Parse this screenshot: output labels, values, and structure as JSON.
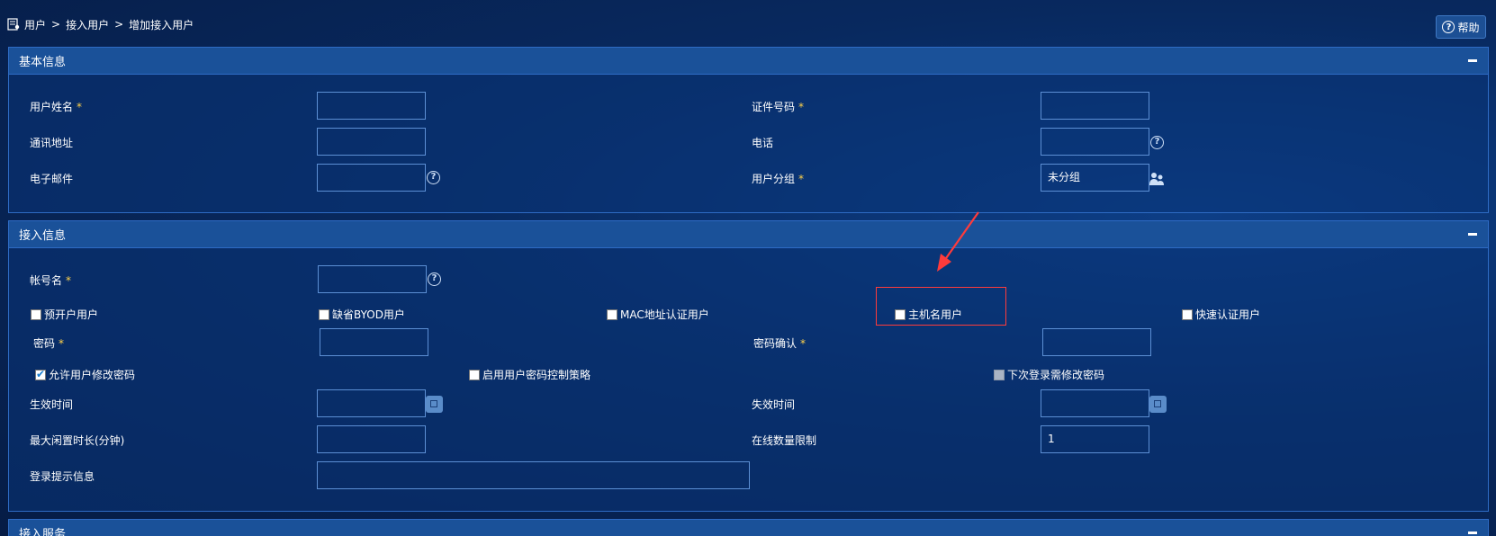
{
  "breadcrumb": {
    "items": [
      "用户",
      "接入用户",
      "增加接入用户"
    ],
    "separator": ">"
  },
  "help": {
    "label": "帮助"
  },
  "basic_panel": {
    "title": "基本信息",
    "fields": {
      "name": {
        "label": "用户姓名",
        "value": ""
      },
      "id_number": {
        "label": "证件号码",
        "value": ""
      },
      "address": {
        "label": "通讯地址",
        "value": ""
      },
      "phone": {
        "label": "电话",
        "value": ""
      },
      "email": {
        "label": "电子邮件",
        "value": ""
      },
      "group": {
        "label": "用户分组",
        "value": "未分组"
      }
    }
  },
  "access_panel": {
    "title": "接入信息",
    "account": {
      "label": "帐号名",
      "value": ""
    },
    "user_types": {
      "preopen": "预开户用户",
      "byod": "缺省BYOD用户",
      "mac": "MAC地址认证用户",
      "hostname": "主机名用户",
      "quick": "快速认证用户"
    },
    "password": {
      "label": "密码",
      "value": ""
    },
    "password_confirm": {
      "label": "密码确认",
      "value": ""
    },
    "options": {
      "allow_modify": "允许用户修改密码",
      "policy": "启用用户密码控制策略",
      "next_login": "下次登录需修改密码"
    },
    "effective_time": {
      "label": "生效时间",
      "value": ""
    },
    "expire_time": {
      "label": "失效时间",
      "value": ""
    },
    "max_idle": {
      "label": "最大闲置时长(分钟)",
      "value": ""
    },
    "online_limit": {
      "label": "在线数量限制",
      "value": "1"
    },
    "login_tip": {
      "label": "登录提示信息",
      "value": ""
    }
  },
  "service_panel": {
    "title": "接入服务"
  },
  "required_mark": "*",
  "help_mark": "?",
  "colors": {
    "accent": "#1a5199",
    "highlight_box": "#ff3b3b",
    "required": "#ffd24a"
  }
}
